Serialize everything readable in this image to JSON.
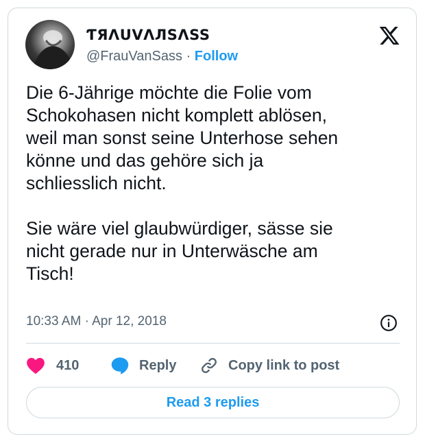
{
  "author": {
    "display_name": "ƬЯΛUVΛЛSΛSS",
    "handle": "@FrauVanSass",
    "separator": "·",
    "follow_label": "Follow"
  },
  "tweet": {
    "text": "Die 6-Jährige möchte die Folie vom\nSchokohasen nicht komplett ablösen,\nweil man sonst seine Unterhose sehen\nkönne und das gehöre sich ja\nschliesslich nicht.\n\nSie wäre viel glaubwürdiger, sässe sie\nnicht gerade nur in Unterwäsche am\nTisch!",
    "time": "10:33 AM",
    "date_separator": "·",
    "date": "Apr 12, 2018"
  },
  "actions": {
    "likes_count": "410",
    "reply_label": "Reply",
    "copy_label": "Copy link to post"
  },
  "footer": {
    "read_replies_label": "Read 3 replies"
  },
  "colors": {
    "accent": "#1d9bf0",
    "heart": "#f91880",
    "muted": "#536471",
    "border": "#cfd9de"
  },
  "icons": [
    "avatar",
    "x-logo-icon",
    "info-icon",
    "heart-icon",
    "reply-bubble-icon",
    "link-icon"
  ]
}
